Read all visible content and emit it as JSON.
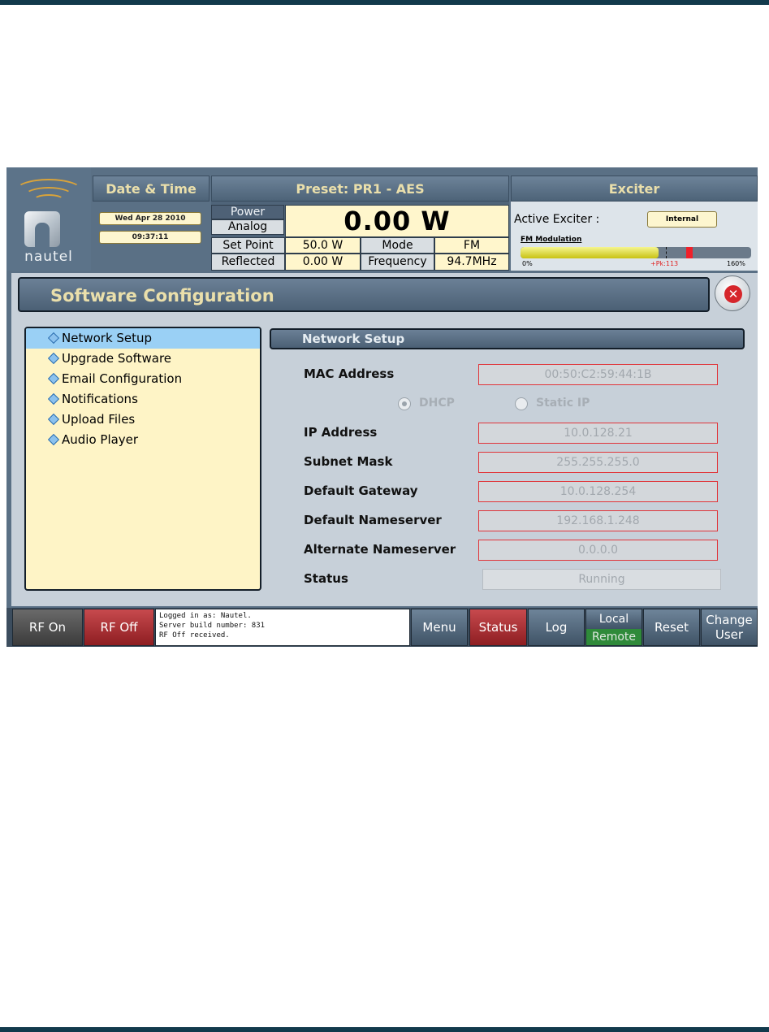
{
  "header": {
    "logo_text": "nautel",
    "date_time": {
      "title": "Date & Time",
      "date": "Wed Apr 28 2010",
      "time": "09:37:11"
    },
    "preset": {
      "title": "Preset: PR1 - AES",
      "power_label": "Power",
      "input_label": "Analog",
      "power_value": "0.00 W",
      "set_point_label": "Set Point",
      "set_point_value": "50.0 W",
      "mode_label": "Mode",
      "mode_value": "FM",
      "reflected_label": "Reflected",
      "reflected_value": "0.00 W",
      "frequency_label": "Frequency",
      "frequency_value": "94.7MHz"
    },
    "exciter": {
      "title": "Exciter",
      "active_label": "Active Exciter :",
      "active_value": "Internal",
      "fm_label": "FM Modulation",
      "fm_level_fraction": 0.6,
      "fm_peak_fraction": 0.72,
      "fm_dash_fraction": 0.63,
      "scale_min": "0%",
      "peak_label": "+Pk:113",
      "scale_max": "160%"
    }
  },
  "dialog": {
    "title": "Software Configuration",
    "nav_items": [
      {
        "label": "Network Setup",
        "active": true
      },
      {
        "label": "Upgrade Software",
        "active": false
      },
      {
        "label": "Email Configuration",
        "active": false
      },
      {
        "label": "Notifications",
        "active": false
      },
      {
        "label": "Upload Files",
        "active": false
      },
      {
        "label": "Audio Player",
        "active": false
      }
    ],
    "detail": {
      "title": "Network Setup",
      "mac_label": "MAC Address",
      "mac_value": "00:50:C2:59:44:1B",
      "dhcp_label": "DHCP",
      "static_label": "Static IP",
      "dhcp_selected": true,
      "ip_label": "IP Address",
      "ip_value": "10.0.128.21",
      "subnet_label": "Subnet Mask",
      "subnet_value": "255.255.255.0",
      "gateway_label": "Default Gateway",
      "gateway_value": "10.0.128.254",
      "nameserver_label": "Default Nameserver",
      "nameserver_value": "192.168.1.248",
      "alt_nameserver_label": "Alternate Nameserver",
      "alt_nameserver_value": "0.0.0.0",
      "status_label": "Status",
      "status_value": "Running"
    }
  },
  "toolbar": {
    "rf_on": "RF On",
    "rf_off": "RF Off",
    "log_line_1": "Logged in as:    Nautel.",
    "log_line_2": "Server build number: 831",
    "log_line_3": "RF Off received.",
    "menu": "Menu",
    "status": "Status",
    "log": "Log",
    "local": "Local",
    "remote": "Remote",
    "reset": "Reset",
    "change_user_1": "Change",
    "change_user_2": "User"
  },
  "colors": {
    "title_text": "#eadfab",
    "panel_bg": "#5a7085",
    "nav_bg": "#fef4c6",
    "nav_active": "#9ad0f5",
    "field_border": "#e0353a",
    "alert_red": "#8e1e22",
    "remote_green": "#2f8a3a"
  },
  "icons": [
    "nautel-logo-icon",
    "close-icon",
    "diamond-bullet-icon",
    "radio-icon"
  ]
}
